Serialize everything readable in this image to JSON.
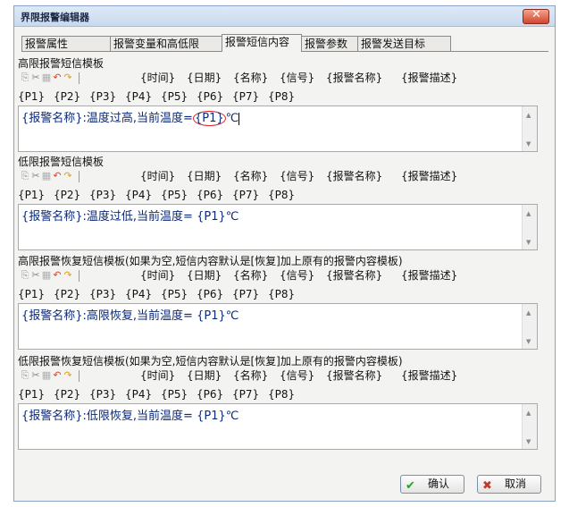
{
  "window": {
    "title": "界限报警编辑器",
    "close_icon": "close-icon"
  },
  "tabs": [
    "报警属性",
    "报警变量和高低限",
    "报警短信内容",
    "报警参数",
    "报警发送目标"
  ],
  "active_tab": 2,
  "toolbar_tokens": [
    "{时间}",
    "{日期}",
    "{名称}",
    "{信号}",
    "{报警名称}",
    "{报警描述}"
  ],
  "param_tokens": [
    "{P1}",
    "{P2}",
    "{P3}",
    "{P4}",
    "{P5}",
    "{P6}",
    "{P7}",
    "{P8}"
  ],
  "sections": [
    {
      "title": "高限报警短信模板",
      "text_prefix": "{报警名称}:温度过高,当前温度=",
      "text_highlight": "{P1}",
      "text_suffix": "℃"
    },
    {
      "title": "低限报警短信模板",
      "text_prefix": "{报警名称}:温度过低,当前温度= {P1}℃",
      "text_highlight": "",
      "text_suffix": ""
    },
    {
      "title": "高限报警恢复短信模板(如果为空,短信内容默认是[恢复]加上原有的报警内容模板)",
      "text_prefix": "{报警名称}:高限恢复,当前温度= {P1}℃",
      "text_highlight": "",
      "text_suffix": ""
    },
    {
      "title": "低限报警恢复短信模板(如果为空,短信内容默认是[恢复]加上原有的报警内容模板)",
      "text_prefix": "{报警名称}:低限恢复,当前温度= {P1}℃",
      "text_highlight": "",
      "text_suffix": ""
    }
  ],
  "buttons": {
    "ok": "确认",
    "cancel": "取消"
  },
  "colors": {
    "accent": "#d22222",
    "check": "#2a9d2a",
    "cancel_x": "#c0392b"
  }
}
